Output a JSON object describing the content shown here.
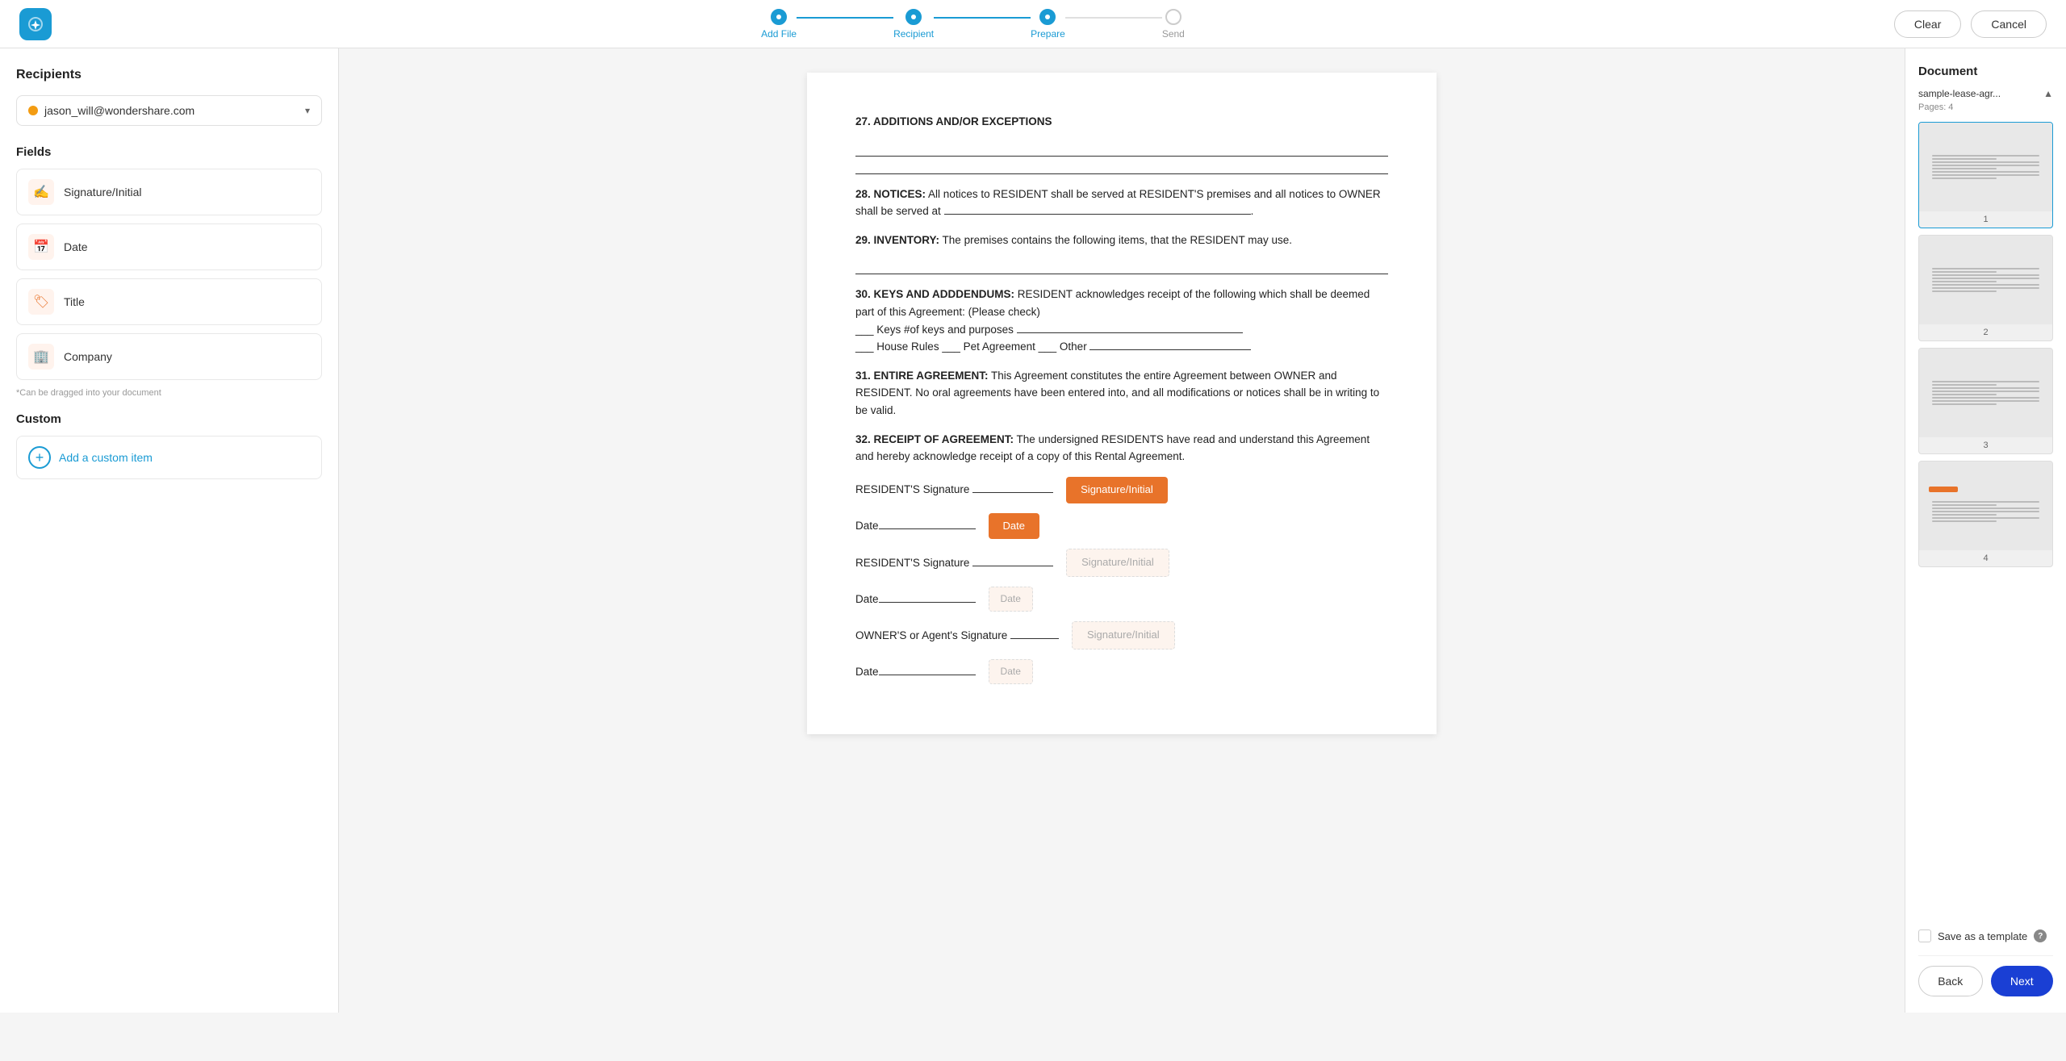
{
  "logo": {
    "alt": "Wondershare"
  },
  "steps": [
    {
      "id": "add-file",
      "label": "Add File",
      "state": "completed"
    },
    {
      "id": "recipient",
      "label": "Recipient",
      "state": "completed"
    },
    {
      "id": "prepare",
      "label": "Prepare",
      "state": "active"
    },
    {
      "id": "send",
      "label": "Send",
      "state": "inactive"
    }
  ],
  "topbar": {
    "clear_label": "Clear",
    "cancel_label": "Cancel"
  },
  "sidebar": {
    "recipients_title": "Recipients",
    "recipient_email": "jason_will@wondershare.com",
    "fields_title": "Fields",
    "fields": [
      {
        "id": "signature",
        "label": "Signature/Initial",
        "icon": "✍"
      },
      {
        "id": "date",
        "label": "Date",
        "icon": "📅"
      },
      {
        "id": "title",
        "label": "Title",
        "icon": "🏷"
      },
      {
        "id": "company",
        "label": "Company",
        "icon": "🏢"
      }
    ],
    "drag_hint": "*Can be dragged into your document",
    "custom_title": "Custom",
    "add_custom_label": "Add a custom item"
  },
  "document": {
    "sections": [
      {
        "num": "27",
        "heading": "ADDITIONS AND/OR EXCEPTIONS",
        "body": ""
      },
      {
        "num": "28",
        "heading": "NOTICES:",
        "body": " All notices to RESIDENT shall be served at RESIDENT'S premises and all notices to OWNER shall be served at _______________________________________________________________________."
      },
      {
        "num": "29",
        "heading": "INVENTORY:",
        "body": " The premises contains the following items, that the RESIDENT may use."
      },
      {
        "num": "30",
        "heading": "KEYS AND ADDDENDUMS:",
        "body": " RESIDENT acknowledges receipt of the following which shall be deemed part of this Agreement: (Please check)\n___ Keys #of keys and purposes ___________________________________________\n___ House Rules ___ Pet Agreement ___ Other _______________________________"
      },
      {
        "num": "31",
        "heading": "ENTIRE AGREEMENT:",
        "body": " This Agreement constitutes the entire Agreement between OWNER and RESIDENT. No oral agreements have been entered into, and all modifications or notices shall be in writing to be valid."
      },
      {
        "num": "32",
        "heading": "RECEIPT OF AGREEMENT:",
        "body": " The undersigned RESIDENTS have read and understand this Agreement and hereby acknowledge receipt of a copy of this Rental Agreement."
      }
    ],
    "sig_fields": [
      {
        "id": "sig1",
        "label": "Signature/Initial",
        "type": "orange"
      },
      {
        "id": "date1",
        "label": "Date",
        "type": "orange-date"
      },
      {
        "id": "sig2",
        "label": "Signature/Initial",
        "type": "outline"
      },
      {
        "id": "date2",
        "label": "Date",
        "type": "outline-date"
      },
      {
        "id": "sig3",
        "label": "Signature/Initial",
        "type": "outline2"
      },
      {
        "id": "date3",
        "label": "Date",
        "type": "outline-date2"
      }
    ],
    "rows": [
      {
        "label": "RESIDENT'S Signature ______",
        "sig": "Signature/Initial",
        "sig_type": "orange"
      },
      {
        "label": "Date_____",
        "sig": "Date",
        "sig_type": "orange-date"
      },
      {
        "label": "RESIDENT'S Signature ______",
        "sig": "Signature/Initial",
        "sig_type": "outline"
      },
      {
        "label": "Date_____",
        "sig": "Date",
        "sig_type": "outline-date"
      },
      {
        "label": "OWNER'S or Agent's Signature _",
        "sig": "Signature/Initial",
        "sig_type": "outline2"
      },
      {
        "label": "Date_____",
        "sig": "Date",
        "sig_type": "outline-date2"
      }
    ]
  },
  "right_panel": {
    "title": "Document",
    "doc_name": "sample-lease-agr...",
    "pages_label": "Pages: 4",
    "pages": [
      {
        "num": "1"
      },
      {
        "num": "2"
      },
      {
        "num": "3"
      },
      {
        "num": "4"
      }
    ],
    "save_template_label": "Save as a template",
    "info_icon": "?",
    "back_label": "Back",
    "next_label": "Next"
  }
}
